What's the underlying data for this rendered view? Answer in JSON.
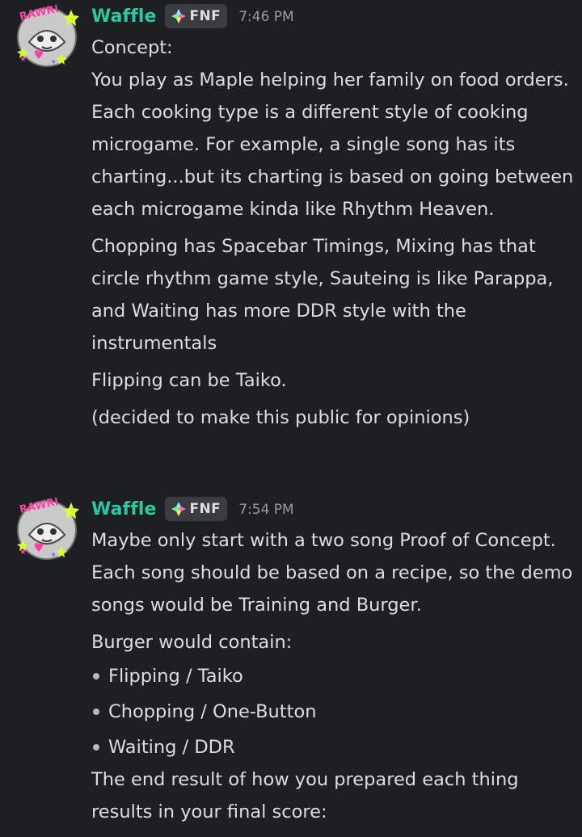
{
  "colors": {
    "background": "#1e1f22",
    "username": "#2dc7a1",
    "text": "#dbdee1",
    "timestamp": "#949ba4",
    "tag_bg": "#3a3c42"
  },
  "messages": [
    {
      "author": "Waffle",
      "tag": "FNF",
      "tag_icon": "diamond-tag-icon",
      "avatar_icon": "avatar-image",
      "time": "7:46 PM",
      "paragraphs": [
        "Concept:\nYou play as Maple helping her family on food orders. Each cooking type is a different style of cooking microgame. For example, a single song has its charting...but its charting is based on going between each microgame kinda like Rhythm Heaven.",
        "Chopping has Spacebar Timings, Mixing has that circle rhythm game style, Sauteing is like Parappa, and Waiting has more DDR style with the instrumentals",
        "Flipping can be Taiko.",
        "(decided to make this public for opinions)"
      ]
    },
    {
      "author": "Waffle",
      "tag": "FNF",
      "tag_icon": "diamond-tag-icon",
      "avatar_icon": "avatar-image",
      "time": "7:54 PM",
      "paragraphs": [
        "Maybe only start with a two song Proof of Concept. Each song should be based on a recipe, so the demo songs would be Training and Burger.",
        "Burger would contain:"
      ],
      "bullets": [
        "Flipping / Taiko",
        "Chopping / One-Button",
        "Waiting / DDR"
      ],
      "closing": "The end result of how you prepared each thing results in your final score:"
    }
  ]
}
